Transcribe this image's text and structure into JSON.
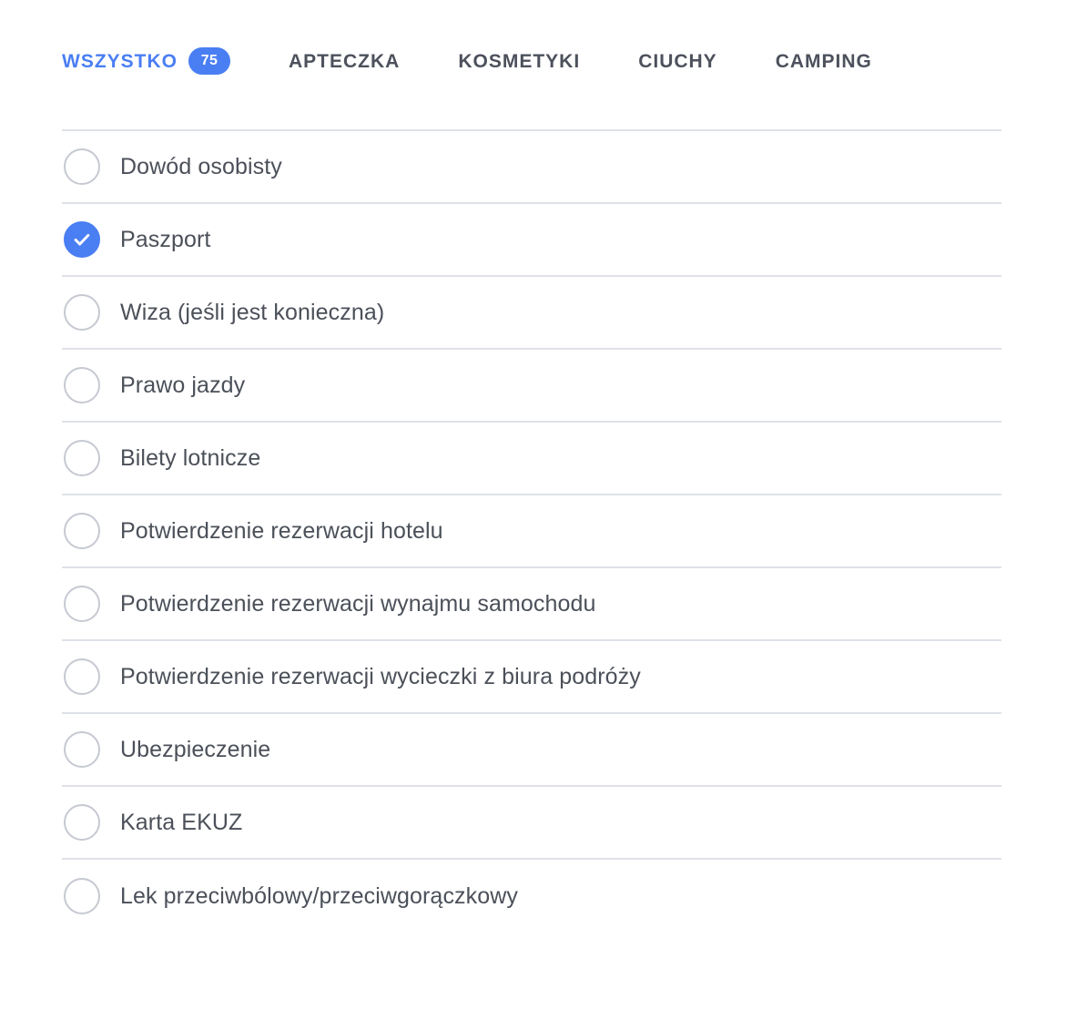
{
  "tabs": [
    {
      "label": "WSZYSTKO",
      "badge": "75",
      "active": true
    },
    {
      "label": "APTECZKA",
      "badge": null,
      "active": false
    },
    {
      "label": "KOSMETYKI",
      "badge": null,
      "active": false
    },
    {
      "label": "CIUCHY",
      "badge": null,
      "active": false
    },
    {
      "label": "CAMPING",
      "badge": null,
      "active": false
    }
  ],
  "colors": {
    "accent": "#4a7ef3",
    "tab_inactive": "#4c515c",
    "item_text": "#4b5059",
    "divider": "#dfe2e8",
    "checkbox_border": "#c6c9d2",
    "background": "#ffffff"
  },
  "checklist": {
    "items": [
      {
        "label": "Dowód osobisty",
        "checked": false
      },
      {
        "label": "Paszport",
        "checked": true
      },
      {
        "label": "Wiza (jeśli jest konieczna)",
        "checked": false
      },
      {
        "label": "Prawo jazdy",
        "checked": false
      },
      {
        "label": "Bilety lotnicze",
        "checked": false
      },
      {
        "label": "Potwierdzenie rezerwacji hotelu",
        "checked": false
      },
      {
        "label": "Potwierdzenie rezerwacji wynajmu samochodu",
        "checked": false
      },
      {
        "label": "Potwierdzenie rezerwacji wycieczki z biura podróży",
        "checked": false
      },
      {
        "label": "Ubezpieczenie",
        "checked": false
      },
      {
        "label": "Karta EKUZ",
        "checked": false
      },
      {
        "label": "Lek przeciwbólowy/przeciwgorączkowy",
        "checked": false
      }
    ]
  },
  "icons": {
    "check": "check-icon"
  }
}
